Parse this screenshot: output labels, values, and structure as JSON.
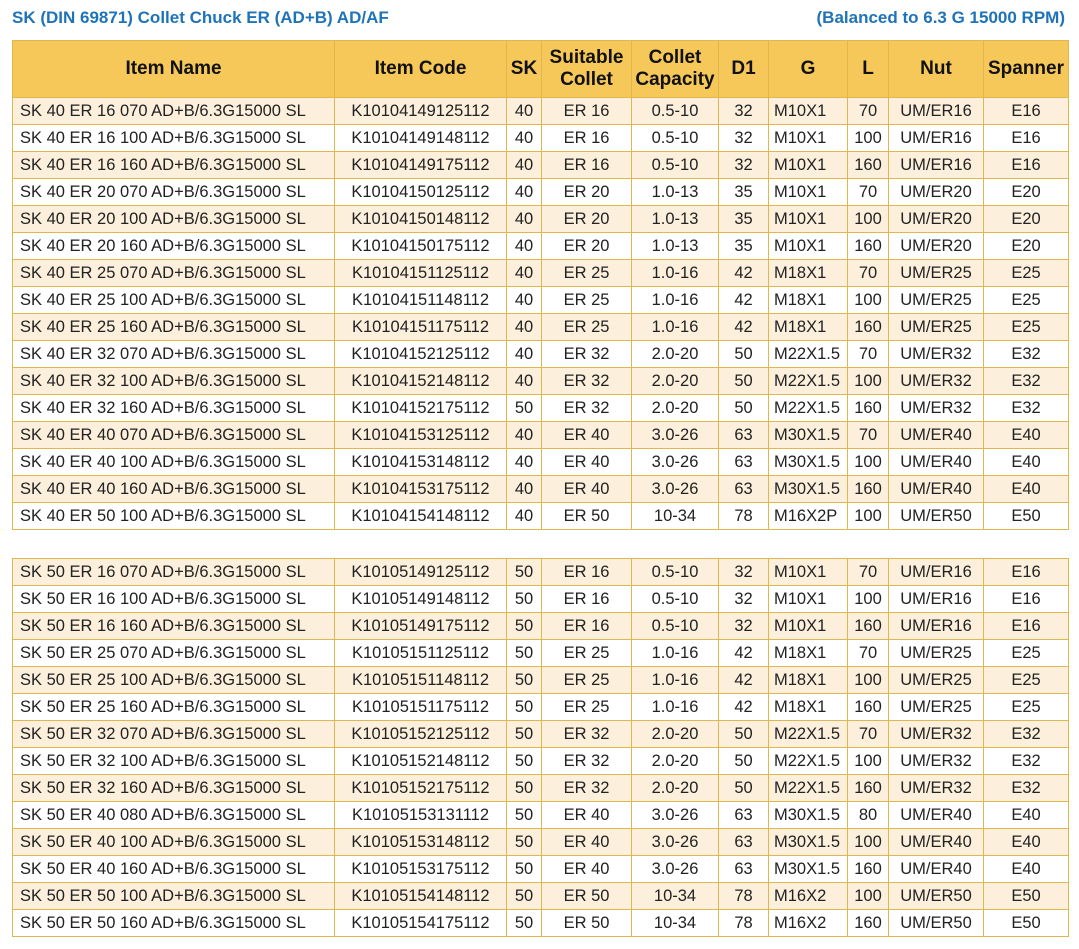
{
  "header": {
    "title": "SK (DIN 69871) Collet Chuck ER (AD+B) AD/AF",
    "balance_note": "(Balanced to 6.3 G 15000 RPM)"
  },
  "columns": {
    "item_name": "Item Name",
    "item_code": "Item Code",
    "sk": "SK",
    "suitable_collet_1": "Suitable",
    "suitable_collet_2": "Collet",
    "collet_capacity_1": "Collet",
    "collet_capacity_2": "Capacity",
    "d1": "D1",
    "g": "G",
    "l": "L",
    "nut": "Nut",
    "spanner": "Spanner"
  },
  "table_top": [
    [
      "SK 40 ER 16 070 AD+B/6.3G15000 SL",
      "K10104149125112",
      "40",
      "ER 16",
      "0.5-10",
      "32",
      "M10X1",
      "70",
      "UM/ER16",
      "E16"
    ],
    [
      "SK 40 ER 16 100 AD+B/6.3G15000 SL",
      "K10104149148112",
      "40",
      "ER 16",
      "0.5-10",
      "32",
      "M10X1",
      "100",
      "UM/ER16",
      "E16"
    ],
    [
      "SK 40 ER 16 160 AD+B/6.3G15000 SL",
      "K10104149175112",
      "40",
      "ER 16",
      "0.5-10",
      "32",
      "M10X1",
      "160",
      "UM/ER16",
      "E16"
    ],
    [
      "SK 40 ER 20 070 AD+B/6.3G15000 SL",
      "K10104150125112",
      "40",
      "ER 20",
      "1.0-13",
      "35",
      "M10X1",
      "70",
      "UM/ER20",
      "E20"
    ],
    [
      "SK 40 ER 20 100 AD+B/6.3G15000 SL",
      "K10104150148112",
      "40",
      "ER 20",
      "1.0-13",
      "35",
      "M10X1",
      "100",
      "UM/ER20",
      "E20"
    ],
    [
      "SK 40 ER 20 160 AD+B/6.3G15000 SL",
      "K10104150175112",
      "40",
      "ER 20",
      "1.0-13",
      "35",
      "M10X1",
      "160",
      "UM/ER20",
      "E20"
    ],
    [
      "SK 40 ER 25 070 AD+B/6.3G15000 SL",
      "K10104151125112",
      "40",
      "ER 25",
      "1.0-16",
      "42",
      "M18X1",
      "70",
      "UM/ER25",
      "E25"
    ],
    [
      "SK 40 ER 25 100 AD+B/6.3G15000 SL",
      "K10104151148112",
      "40",
      "ER 25",
      "1.0-16",
      "42",
      "M18X1",
      "100",
      "UM/ER25",
      "E25"
    ],
    [
      "SK 40 ER 25 160 AD+B/6.3G15000 SL",
      "K10104151175112",
      "40",
      "ER 25",
      "1.0-16",
      "42",
      "M18X1",
      "160",
      "UM/ER25",
      "E25"
    ],
    [
      "SK 40 ER 32 070 AD+B/6.3G15000 SL",
      "K10104152125112",
      "40",
      "ER 32",
      "2.0-20",
      "50",
      "M22X1.5",
      "70",
      "UM/ER32",
      "E32"
    ],
    [
      "SK 40 ER 32 100 AD+B/6.3G15000 SL",
      "K10104152148112",
      "40",
      "ER 32",
      "2.0-20",
      "50",
      "M22X1.5",
      "100",
      "UM/ER32",
      "E32"
    ],
    [
      "SK 40 ER 32 160 AD+B/6.3G15000 SL",
      "K10104152175112",
      "50",
      "ER 32",
      "2.0-20",
      "50",
      "M22X1.5",
      "160",
      "UM/ER32",
      "E32"
    ],
    [
      "SK 40 ER 40 070 AD+B/6.3G15000 SL",
      "K10104153125112",
      "40",
      "ER 40",
      "3.0-26",
      "63",
      "M30X1.5",
      "70",
      "UM/ER40",
      "E40"
    ],
    [
      "SK 40 ER 40 100 AD+B/6.3G15000 SL",
      "K10104153148112",
      "40",
      "ER 40",
      "3.0-26",
      "63",
      "M30X1.5",
      "100",
      "UM/ER40",
      "E40"
    ],
    [
      "SK 40 ER 40 160 AD+B/6.3G15000 SL",
      "K10104153175112",
      "40",
      "ER 40",
      "3.0-26",
      "63",
      "M30X1.5",
      "160",
      "UM/ER40",
      "E40"
    ],
    [
      "SK 40 ER 50 100 AD+B/6.3G15000 SL",
      "K10104154148112",
      "40",
      "ER 50",
      "10-34",
      "78",
      "M16X2P",
      "100",
      "UM/ER50",
      "E50"
    ]
  ],
  "table_bottom": [
    [
      "SK 50 ER 16 070 AD+B/6.3G15000 SL",
      "K10105149125112",
      "50",
      "ER 16",
      "0.5-10",
      "32",
      "M10X1",
      "70",
      "UM/ER16",
      "E16"
    ],
    [
      "SK 50 ER 16 100 AD+B/6.3G15000 SL",
      "K10105149148112",
      "50",
      "ER 16",
      "0.5-10",
      "32",
      "M10X1",
      "100",
      "UM/ER16",
      "E16"
    ],
    [
      "SK 50 ER 16 160 AD+B/6.3G15000 SL",
      "K10105149175112",
      "50",
      "ER 16",
      "0.5-10",
      "32",
      "M10X1",
      "160",
      "UM/ER16",
      "E16"
    ],
    [
      "SK 50 ER 25 070 AD+B/6.3G15000 SL",
      "K10105151125112",
      "50",
      "ER 25",
      "1.0-16",
      "42",
      "M18X1",
      "70",
      "UM/ER25",
      "E25"
    ],
    [
      "SK 50 ER 25 100 AD+B/6.3G15000 SL",
      "K10105151148112",
      "50",
      "ER 25",
      "1.0-16",
      "42",
      "M18X1",
      "100",
      "UM/ER25",
      "E25"
    ],
    [
      "SK 50 ER 25 160 AD+B/6.3G15000 SL",
      "K10105151175112",
      "50",
      "ER 25",
      "1.0-16",
      "42",
      "M18X1",
      "160",
      "UM/ER25",
      "E25"
    ],
    [
      "SK 50 ER 32 070 AD+B/6.3G15000 SL",
      "K10105152125112",
      "50",
      "ER 32",
      "2.0-20",
      "50",
      "M22X1.5",
      "70",
      "UM/ER32",
      "E32"
    ],
    [
      "SK 50 ER 32 100 AD+B/6.3G15000 SL",
      "K10105152148112",
      "50",
      "ER 32",
      "2.0-20",
      "50",
      "M22X1.5",
      "100",
      "UM/ER32",
      "E32"
    ],
    [
      "SK 50 ER 32 160 AD+B/6.3G15000 SL",
      "K10105152175112",
      "50",
      "ER 32",
      "2.0-20",
      "50",
      "M22X1.5",
      "160",
      "UM/ER32",
      "E32"
    ],
    [
      "SK 50 ER 40 080 AD+B/6.3G15000 SL",
      "K10105153131112",
      "50",
      "ER 40",
      "3.0-26",
      "63",
      "M30X1.5",
      "80",
      "UM/ER40",
      "E40"
    ],
    [
      "SK 50 ER 40 100 AD+B/6.3G15000 SL",
      "K10105153148112",
      "50",
      "ER 40",
      "3.0-26",
      "63",
      "M30X1.5",
      "100",
      "UM/ER40",
      "E40"
    ],
    [
      "SK 50 ER 40 160 AD+B/6.3G15000 SL",
      "K10105153175112",
      "50",
      "ER 40",
      "3.0-26",
      "63",
      "M30X1.5",
      "160",
      "UM/ER40",
      "E40"
    ],
    [
      "SK 50 ER 50 100 AD+B/6.3G15000 SL",
      "K10105154148112",
      "50",
      "ER 50",
      "10-34",
      "78",
      "M16X2",
      "100",
      "UM/ER50",
      "E50"
    ],
    [
      "SK 50 ER 50 160 AD+B/6.3G15000 SL",
      "K10105154175112",
      "50",
      "ER 50",
      "10-34",
      "78",
      "M16X2",
      "160",
      "UM/ER50",
      "E50"
    ]
  ]
}
